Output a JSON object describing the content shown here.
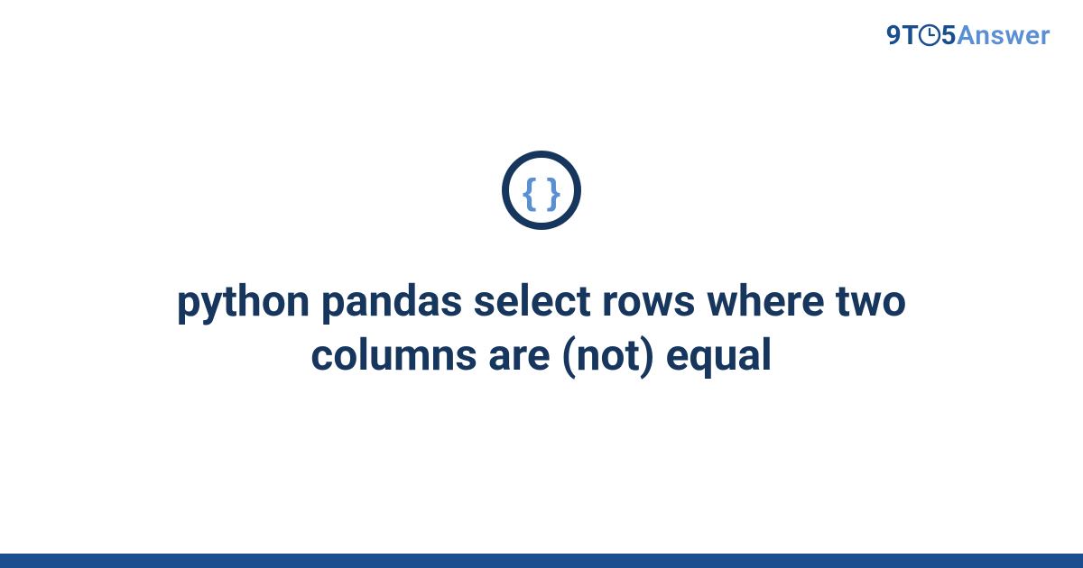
{
  "brand": {
    "part1": "9",
    "part2": "T",
    "part3": "5",
    "part4": "Answer"
  },
  "title": "python pandas select rows where two columns are (not) equal",
  "colors": {
    "brand_dark": "#1a4e8e",
    "brand_light": "#5a8fd4",
    "title_color": "#17365d",
    "footer_bar": "#1a4e8e"
  }
}
